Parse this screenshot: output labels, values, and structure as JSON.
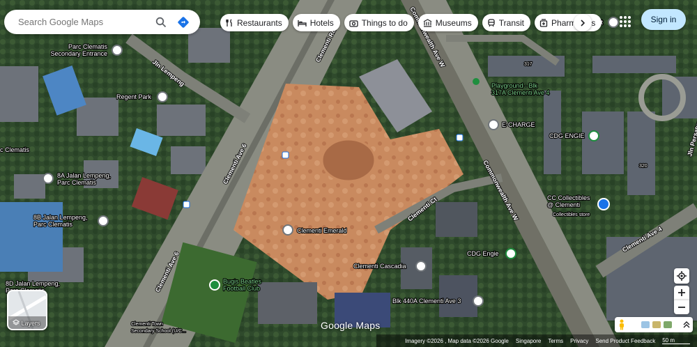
{
  "search": {
    "placeholder": "Search Google Maps"
  },
  "chips": [
    {
      "label": "Restaurants",
      "icon": "fork-knife-icon"
    },
    {
      "label": "Hotels",
      "icon": "bed-icon"
    },
    {
      "label": "Things to do",
      "icon": "camera-icon"
    },
    {
      "label": "Museums",
      "icon": "museum-icon"
    },
    {
      "label": "Transit",
      "icon": "train-icon"
    },
    {
      "label": "Pharmacies",
      "icon": "pharmacy-icon"
    }
  ],
  "header": {
    "signin_label": "Sign in"
  },
  "layers": {
    "label": "Layers"
  },
  "logo": "Google Maps",
  "places": [
    {
      "name": "Parc Clematis\nSecondary Entrance",
      "icon": "place-pin-icon"
    },
    {
      "name": "Regent Park",
      "icon": "place-pin-icon"
    },
    {
      "name": "c Clematis",
      "icon": ""
    },
    {
      "name": "8A Jalan Lempeng,\nParc Clematis",
      "icon": "place-pin-icon"
    },
    {
      "name": "8B Jalan Lempeng,\nParc Clematis",
      "icon": "place-pin-icon"
    },
    {
      "name": "8D Jalan Lempeng,\nParc Clematis",
      "icon": ""
    },
    {
      "name": "Clementi Emerald",
      "icon": "place-pin-icon"
    },
    {
      "name": "Clementi Cascadia",
      "icon": "place-pin-icon"
    },
    {
      "name": "Blk 440A Clementi Ave 3",
      "icon": "place-pin-icon"
    },
    {
      "name": "CDG Engie",
      "icon": "charging-icon"
    },
    {
      "name": "E-CHARGE",
      "icon": "place-pin-icon"
    },
    {
      "name": "CDG ENGIE",
      "icon": "charging-icon"
    },
    {
      "name": "Playground - Blk\n317A Clementi Ave 4",
      "icon": "playground-icon"
    },
    {
      "name": "CC Collectibles\n@ Clementi",
      "icon": "shopping-bag-icon"
    },
    {
      "name": "Collectibles store",
      "icon": ""
    },
    {
      "name": "Bugis Beatles\nFootball Club",
      "icon": "park-pin-icon"
    },
    {
      "name": "Clementi Town\nSecondary School (U/C...",
      "icon": ""
    },
    {
      "name": "317",
      "icon": ""
    },
    {
      "name": "320",
      "icon": ""
    },
    {
      "name": "-Fit",
      "icon": ""
    }
  ],
  "roads": [
    "Jln Lempeng",
    "Clementi Ave 6",
    "Clementi Ave 6",
    "Clementi Rd",
    "Commonwealth Ave W",
    "Commonwealth Ave W",
    "Clementi Ct",
    "Clementi Ave 4",
    "Jln Persatuan"
  ],
  "footer": {
    "imagery": "Imagery ©2026 , Map data ©2026 Google",
    "country": "Singapore",
    "terms": "Terms",
    "privacy": "Privacy",
    "feedback": "Send Product Feedback",
    "scale": "50 m"
  },
  "colors": {
    "signin_bg": "#c2e7ff",
    "pin_blue": "#1a73e8",
    "pin_green": "#1e8e3e",
    "construction": "#c9875e"
  }
}
